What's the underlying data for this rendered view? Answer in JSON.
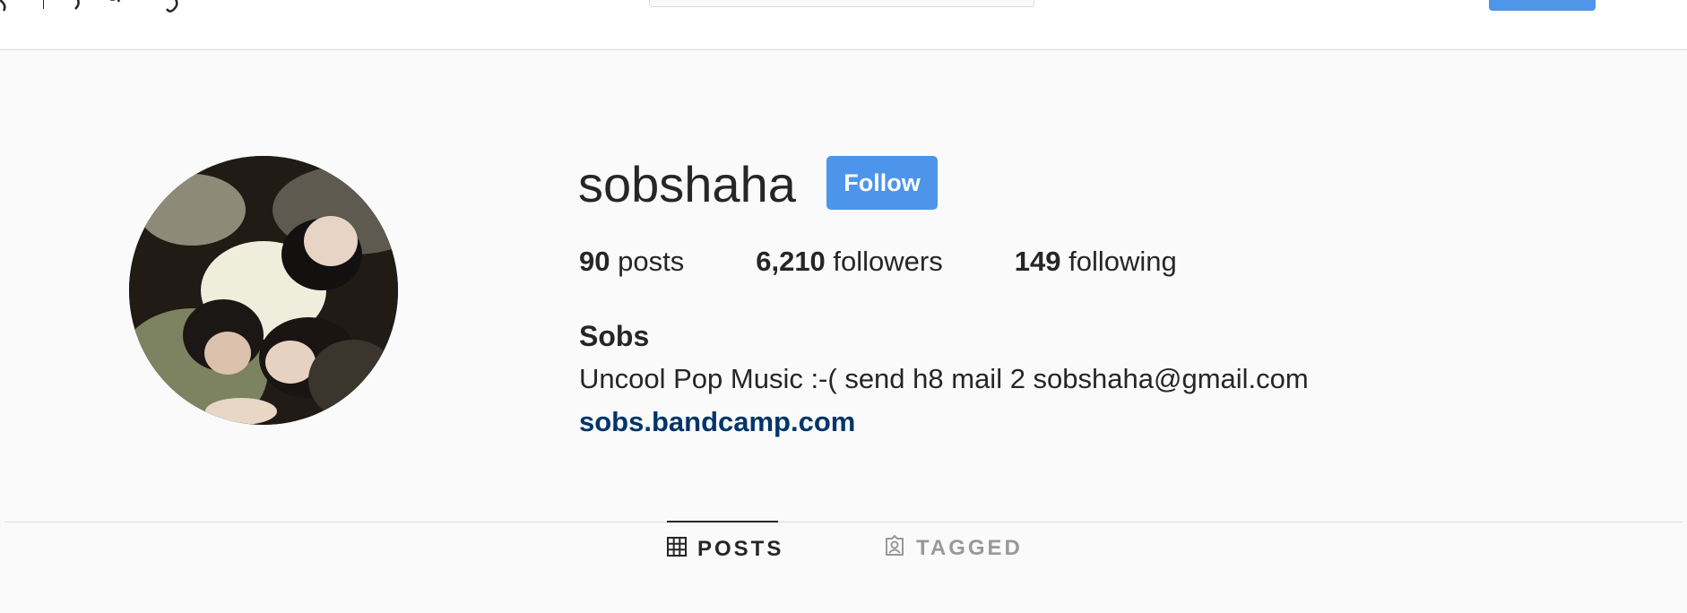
{
  "profile": {
    "username": "sobshaha",
    "follow_label": "Follow",
    "stats": [
      {
        "count": "90",
        "label": "posts"
      },
      {
        "count": "6,210",
        "label": "followers"
      },
      {
        "count": "149",
        "label": "following"
      }
    ],
    "full_name": "Sobs",
    "bio": "Uncool Pop Music :-( send h8 mail 2 sobshaha@gmail.com",
    "link": "sobs.bandcamp.com"
  },
  "tabs": [
    {
      "label": "POSTS",
      "icon": "grid-icon",
      "active": true
    },
    {
      "label": "TAGGED",
      "icon": "tagged-icon",
      "active": false
    }
  ],
  "colors": {
    "accent": "#4d95ea",
    "link": "#003569",
    "background": "#fafafa"
  }
}
